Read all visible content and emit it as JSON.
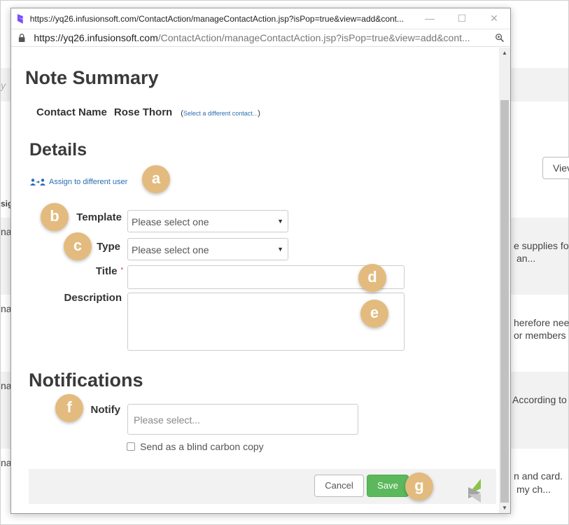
{
  "window": {
    "title": "https://yq26.infusionsoft.com/ContactAction/manageContactAction.jsp?isPop=true&view=add&cont...",
    "url_host": "https://yq26.infusionsoft.com",
    "url_path": "/ContactAction/manageContactAction.jsp?isPop=true&view=add&cont..."
  },
  "page": {
    "heading": "Note Summary",
    "contact_label": "Contact Name",
    "contact_name": "Rose Thorn",
    "select_contact_link": "Select a different contact...",
    "details_heading": "Details",
    "assign_link": "Assign to different user",
    "template_label": "Template",
    "template_value": "Please select one",
    "type_label": "Type",
    "type_value": "Please select one",
    "title_label": "Title",
    "required_mark": "•",
    "description_label": "Description",
    "notifications_heading": "Notifications",
    "notify_label": "Notify",
    "notify_placeholder": "Please select...",
    "bcc_label": "Send as a blind carbon copy",
    "cancel_label": "Cancel",
    "save_label": "Save"
  },
  "callouts": [
    "a",
    "b",
    "c",
    "d",
    "e",
    "f",
    "g"
  ],
  "background": {
    "fragments": [
      "y",
      "sig",
      "na",
      "na",
      "na",
      "na",
      "Viev",
      "e supplies fo",
      "an...",
      "herefore nee",
      "or members",
      "According to",
      "n and card.",
      "my ch..."
    ]
  },
  "colors": {
    "link": "#2b6cb0",
    "save_button": "#5cb85c",
    "callout": "#e3bb7e",
    "required": "#e57373"
  },
  "icons": [
    "app-logo-icon",
    "minimize-icon",
    "maximize-icon",
    "close-icon",
    "lock-icon",
    "zoom-icon",
    "assign-user-icon",
    "chevron-down-icon",
    "brand-logo-icon"
  ]
}
